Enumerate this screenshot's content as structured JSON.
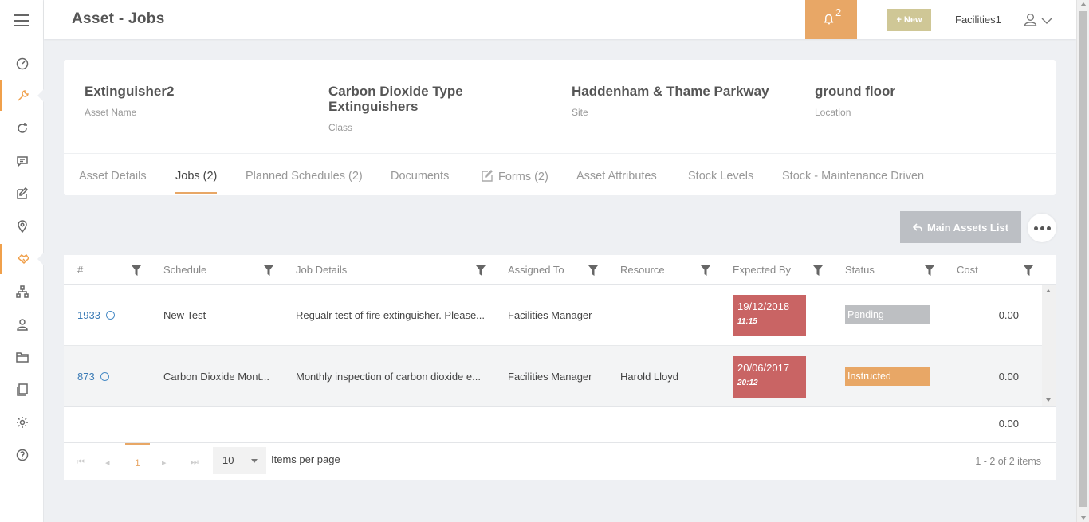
{
  "header": {
    "title": "Asset - Jobs",
    "notifications_count": "2",
    "new_button": "+ New",
    "user_name": "Facilities1"
  },
  "asset": {
    "name_value": "Extinguisher2",
    "name_label": "Asset Name",
    "class_value": "Carbon Dioxide Type Extinguishers",
    "class_label": "Class",
    "site_value": "Haddenham & Thame Parkway",
    "site_label": "Site",
    "location_value": "ground floor",
    "location_label": "Location"
  },
  "tabs": [
    {
      "label": "Asset Details"
    },
    {
      "label": "Jobs (2)"
    },
    {
      "label": "Planned Schedules (2)"
    },
    {
      "label": "Documents"
    },
    {
      "label": "Forms (2)"
    },
    {
      "label": "Asset Attributes"
    },
    {
      "label": "Stock Levels"
    },
    {
      "label": "Stock - Maintenance Driven"
    }
  ],
  "actions": {
    "main_assets_list": "Main Assets List"
  },
  "grid": {
    "columns": [
      "#",
      "Schedule",
      "Job Details",
      "Assigned To",
      "Resource",
      "Expected By",
      "Status",
      "Cost"
    ],
    "rows": [
      {
        "id": "1933",
        "schedule": "New Test",
        "job_details": "Regualr test of fire extinguisher. Please...",
        "assigned_to": "Facilities Manager",
        "resource": "",
        "expected_date": "19/12/2018",
        "expected_time": "11:15",
        "status": "Pending",
        "status_color": "#bdbfc2",
        "cost": "0.00"
      },
      {
        "id": "873",
        "schedule": "Carbon Dioxide Mont...",
        "job_details": "Monthly inspection of carbon dioxide e...",
        "assigned_to": "Facilities Manager",
        "resource": "Harold Lloyd",
        "expected_date": "20/06/2017",
        "expected_time": "20:12",
        "status": "Instructed",
        "status_color": "#e8a766",
        "cost": "0.00"
      }
    ],
    "total_cost": "0.00"
  },
  "pager": {
    "current_page": "1",
    "page_size": "10",
    "items_per_page_label": "Items per page",
    "range_text": "1 - 2 of 2 items"
  },
  "colors": {
    "accent": "#e8a766",
    "expected_overdue": "#c96464",
    "new_button": "#cfc796"
  }
}
